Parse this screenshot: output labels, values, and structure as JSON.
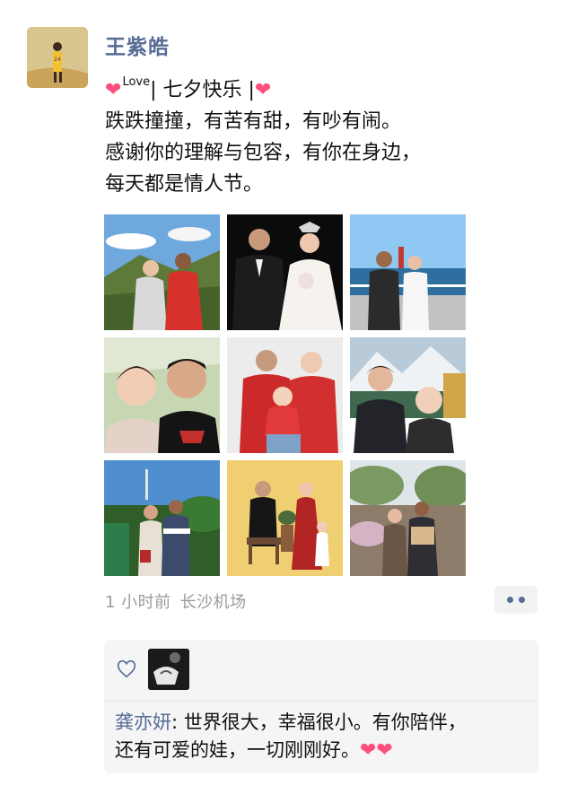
{
  "post": {
    "username": "王紫皓",
    "text": {
      "heart_glyph": "❤",
      "love_sup": "Love",
      "line1_mid": "| 七夕快乐 |",
      "line2": "跌跌撞撞，有苦有甜，有吵有闹。",
      "line3": "感谢你的理解与包容，有你在身边，",
      "line4": "每天都是情人节。"
    },
    "time": "1 小时前",
    "location": "长沙机场"
  },
  "photos": [
    {
      "icon": "couple-mountain-photo"
    },
    {
      "icon": "wedding-photo"
    },
    {
      "icon": "couple-seaside-photo"
    },
    {
      "icon": "couple-selfie-photo"
    },
    {
      "icon": "family-photo"
    },
    {
      "icon": "couple-snow-mountain-photo"
    },
    {
      "icon": "couple-tropical-photo"
    },
    {
      "icon": "family-studio-photo"
    },
    {
      "icon": "couple-park-photo"
    }
  ],
  "interactions": {
    "like_icon": "heart-outline-icon",
    "comments": [
      {
        "author": "龚亦妍",
        "separator": ":",
        "line1": " 世界很大，幸福很小。有你陪伴，",
        "line2": "还有可爱的娃，一切刚刚好。",
        "hearts": "❤❤"
      }
    ]
  },
  "colors": {
    "name_blue": "#576b95",
    "heart_pink": "#ff4f7e",
    "meta_gray": "#9b9b9b",
    "panel_bg": "#f5f5f5"
  }
}
